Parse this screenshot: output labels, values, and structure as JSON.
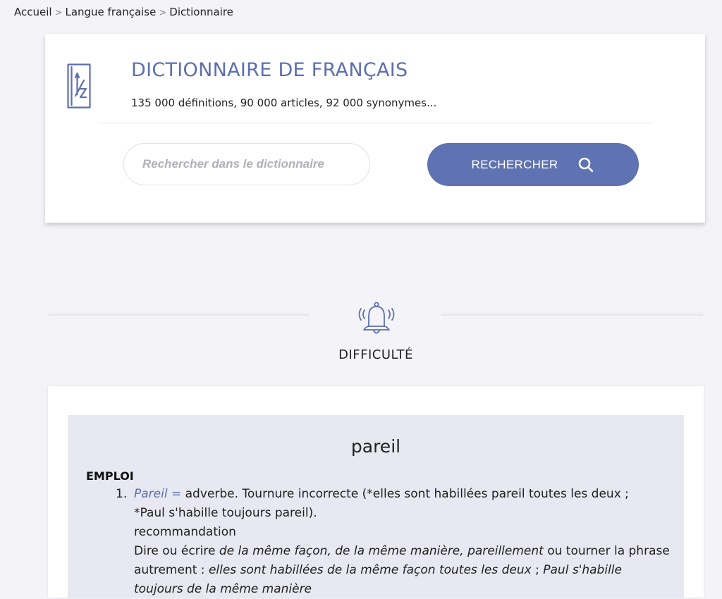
{
  "breadcrumb": {
    "items": [
      "Accueil",
      "Langue française",
      "Dictionnaire"
    ],
    "separator": ">"
  },
  "dictionary": {
    "title": "DICTIONNAIRE DE FRANÇAIS",
    "subtitle": "135 000 définitions, 90 000 articles, 92 000 synonymes...",
    "logo_icon": "a-to-z-dictionary-icon",
    "search": {
      "placeholder": "Rechercher dans le dictionnaire",
      "value": "",
      "button_label": "RECHERCHER",
      "button_icon": "search-icon"
    }
  },
  "section": {
    "icon": "bell-icon",
    "title": "DIFFICULTÉ"
  },
  "entry": {
    "word": "pareil",
    "section_label": "EMPLOI",
    "items": [
      {
        "number": "1.",
        "term": "Pareil =",
        "line1_rest": " adverbe. Tournure incorrecte (*elles sont habillées pareil toutes les deux ;",
        "line2": "*Paul s'habille toujours pareil).",
        "reco_label": "recommandation",
        "reco_intro": "Dire ou écrire ",
        "reco_forms": "de la même façon, de la même manière, pareillement",
        "reco_mid": " ou tourner la phrase autrement : ",
        "example1": "elles sont habillées de la même façon toutes les deux",
        "example_sep": " ; ",
        "example2": "Paul s'habille toujours de la même manière"
      }
    ]
  },
  "colors": {
    "accent": "#5f72b2",
    "page_background": "#f3f3f8",
    "panel_background": "#e7e8f1"
  }
}
